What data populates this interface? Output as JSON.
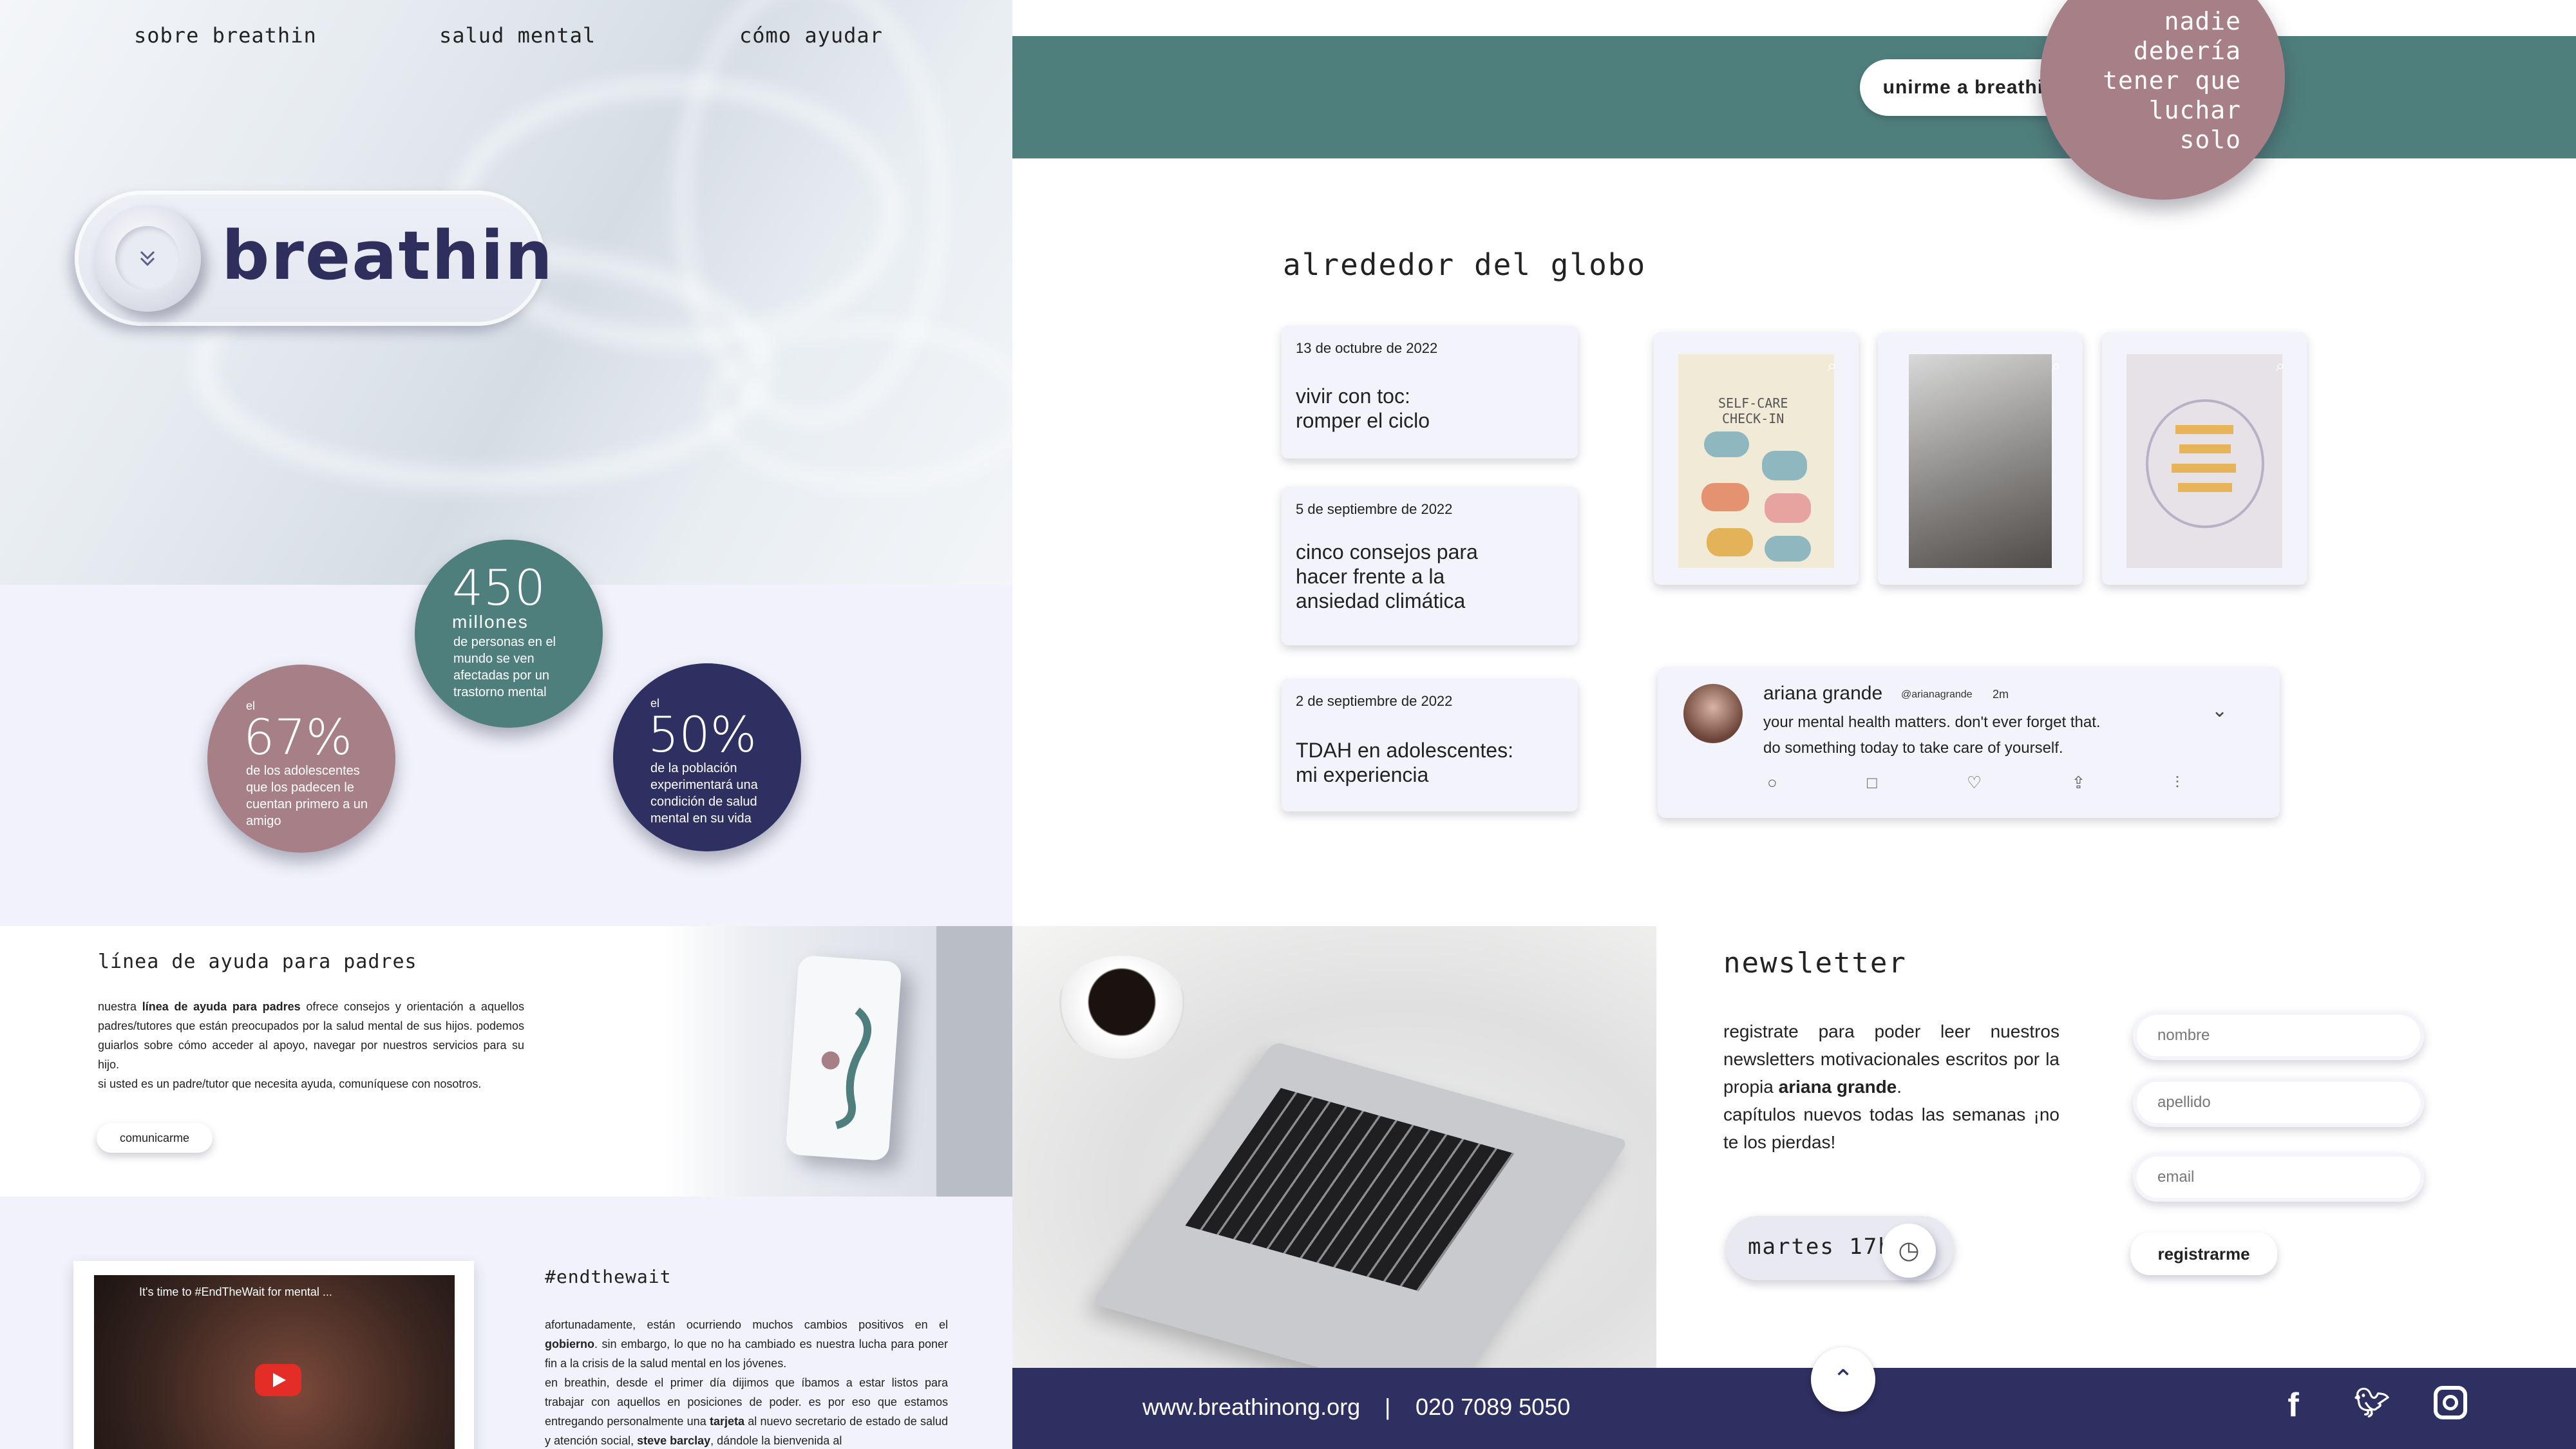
{
  "nav": {
    "items": [
      "sobre breathin",
      "salud mental",
      "cómo ayudar"
    ]
  },
  "brand": {
    "logo": "breathin"
  },
  "stats": {
    "s1": {
      "value": "450",
      "unit": "millones",
      "desc": "de personas en el mundo se ven afectadas por un trastorno mental",
      "color": "#4f7f7d"
    },
    "s2": {
      "pre": "el",
      "value": "67%",
      "desc": "de los adolescentes que los padecen le cuentan primero a un amigo",
      "color": "#a67f87"
    },
    "s3": {
      "pre": "el",
      "value": "50%",
      "desc": "de la población experimentará una condición de salud mental en su vida",
      "color": "#2f3062"
    }
  },
  "helpline": {
    "title": "línea de ayuda para padres",
    "body_1": "nuestra ",
    "body_bold": "línea de ayuda para padres",
    "body_2": " ofrece consejos y orientación a aquellos padres/tutores que están preocupados por la salud mental de sus hijos. podemos guiarlos sobre cómo acceder al apoyo, navegar por nuestros servicios para su hijo.",
    "body_3": "si usted es un padre/tutor que necesita ayuda, comuníquese con nosotros.",
    "button": "comunicarme"
  },
  "endthewait": {
    "title": "#endthewait",
    "video_title": "It's time to #EndTheWait for mental ...",
    "body_a1": "afortunadamente, están ocurriendo muchos cambios positivos en el ",
    "body_a_bold": "gobierno",
    "body_a2": ". sin embargo, lo que no ha cambiado es nuestra lucha para poner fin a la crisis de la salud mental en los jóvenes.",
    "body_b1": "en breathin, desde el primer día dijimos que íbamos a estar listos para trabajar con aquellos en posiciones de poder. es por eso que estamos entregando personalmente una ",
    "body_b_bold1": "tarjeta",
    "body_b2": " al nuevo secretario de estado de salud y atención social, ",
    "body_b_bold2": "steve barclay",
    "body_b3": ", dándole la bienvenida al"
  },
  "header": {
    "join_button": "unirme a breathin",
    "slogan": [
      "nadie",
      "debería",
      "tener que",
      "luchar",
      "solo"
    ]
  },
  "globe": {
    "title": "alrededor del globo",
    "news": [
      {
        "date": "13 de octubre de 2022",
        "title_1": "vivir con toc:",
        "title_2": "romper el ciclo"
      },
      {
        "date": "5 de septiembre de 2022",
        "title_1": "cinco consejos para",
        "title_2": "hacer frente a la",
        "title_3": "ansiedad climática"
      },
      {
        "date": "2 de septiembre de 2022",
        "title_1": "TDAH en adolescentes:",
        "title_2": "mi experiencia"
      }
    ],
    "image_card_1": {
      "heading_1": "SELF-CARE",
      "heading_2": "CHECK-IN"
    },
    "tweet": {
      "name": "ariana grande",
      "handle": "@arianagrande",
      "time": "2m",
      "line_1": "your mental health matters. don't ever forget that.",
      "line_2": "do something today to take care of yourself."
    }
  },
  "newsletter": {
    "title": "newsletter",
    "body_1": "registrate para poder leer nuestros newsletters motivacionales escritos por la propia ",
    "body_bold": "ariana grande",
    "body_2": ".",
    "body_3": "capítulos nuevos todas las semanas ¡no te los pierdas!",
    "schedule": "martes 17hs",
    "fields": {
      "nombre": "nombre",
      "apellido": "apellido",
      "email": "email"
    },
    "submit": "registrarme"
  },
  "footer": {
    "website": "www.breathinong.org",
    "separator": "|",
    "phone": "020 7089 5050"
  },
  "colors": {
    "teal": "#4f7f7d",
    "rose": "#a67f87",
    "navy": "#2f3062",
    "lavender": "#f1f2fb"
  },
  "icons": [
    "chevron-down-icon",
    "clock-icon",
    "search-zoom-icon",
    "reply-icon",
    "retweet-icon",
    "heart-icon",
    "share-icon",
    "stats-icon",
    "arrow-up-icon",
    "facebook-icon",
    "twitter-icon",
    "instagram-icon",
    "youtube-play-icon"
  ]
}
